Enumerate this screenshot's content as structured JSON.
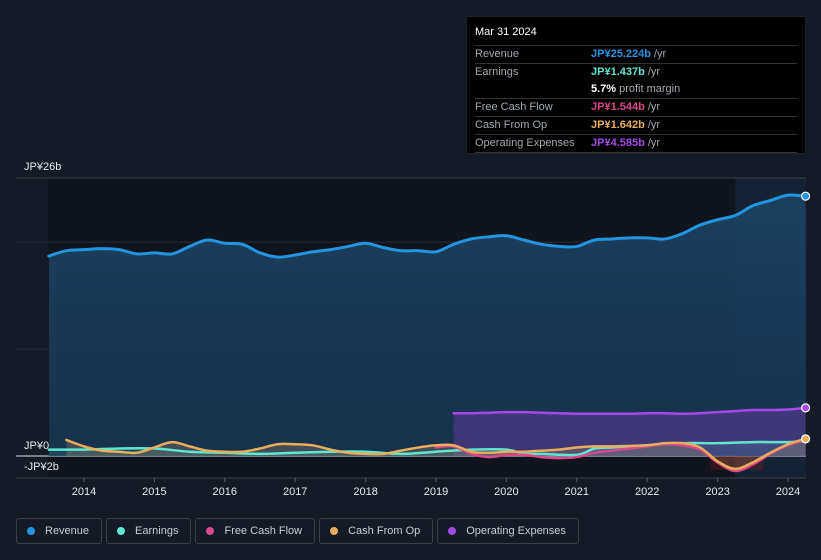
{
  "tooltip": {
    "date": "Mar 31 2024",
    "rows": [
      {
        "label": "Revenue",
        "value": "JP¥25.224b",
        "unit": "/yr",
        "color": "#2394df"
      },
      {
        "label": "Earnings",
        "value": "JP¥1.437b",
        "unit": "/yr",
        "color": "#5ee6d0"
      },
      {
        "label": "",
        "value": "5.7%",
        "unit": "profit margin",
        "color": "#ffffff"
      },
      {
        "label": "Free Cash Flow",
        "value": "JP¥1.544b",
        "unit": "/yr",
        "color": "#d9488b"
      },
      {
        "label": "Cash From Op",
        "value": "JP¥1.642b",
        "unit": "/yr",
        "color": "#e9ad5b"
      },
      {
        "label": "Operating Expenses",
        "value": "JP¥4.585b",
        "unit": "/yr",
        "color": "#a548e8"
      }
    ]
  },
  "legend": [
    {
      "label": "Revenue",
      "color": "#2394df"
    },
    {
      "label": "Earnings",
      "color": "#5ee6d0"
    },
    {
      "label": "Free Cash Flow",
      "color": "#d9488b"
    },
    {
      "label": "Cash From Op",
      "color": "#e9ad5b"
    },
    {
      "label": "Operating Expenses",
      "color": "#a548e8"
    }
  ],
  "chart_data": {
    "type": "area",
    "title": "",
    "xlabel": "",
    "ylabel": "",
    "y_tick_labels": {
      "top": "JP¥26b",
      "zero": "JP¥0",
      "bottom": "-JP¥2b"
    },
    "ylim": [
      -2,
      26
    ],
    "xlim": [
      2013.15,
      2024.3
    ],
    "x_ticks": [
      2014,
      2015,
      2016,
      2017,
      2018,
      2019,
      2020,
      2021,
      2022,
      2023,
      2024
    ],
    "highlight_from": 2023.25,
    "grid": true,
    "legend_position": "bottom-left",
    "series": [
      {
        "name": "Revenue",
        "color": "#2394df",
        "fill": true,
        "x": [
          2013.5,
          2013.75,
          2014.0,
          2014.25,
          2014.5,
          2014.75,
          2015.0,
          2015.25,
          2015.5,
          2015.75,
          2016.0,
          2016.25,
          2016.5,
          2016.75,
          2017.0,
          2017.25,
          2017.5,
          2017.75,
          2018.0,
          2018.25,
          2018.5,
          2018.75,
          2019.0,
          2019.25,
          2019.5,
          2019.75,
          2020.0,
          2020.25,
          2020.5,
          2020.75,
          2021.0,
          2021.25,
          2021.5,
          2021.75,
          2022.0,
          2022.25,
          2022.5,
          2022.75,
          2023.0,
          2023.25,
          2023.5,
          2023.75,
          2024.0,
          2024.25
        ],
        "values": [
          18.7,
          19.2,
          19.3,
          19.4,
          19.3,
          18.9,
          19.0,
          18.9,
          19.6,
          20.2,
          19.9,
          19.8,
          19.0,
          18.6,
          18.8,
          19.1,
          19.3,
          19.6,
          19.9,
          19.5,
          19.2,
          19.2,
          19.1,
          19.8,
          20.3,
          20.5,
          20.6,
          20.2,
          19.8,
          19.6,
          19.6,
          20.2,
          20.3,
          20.4,
          20.4,
          20.3,
          20.8,
          21.6,
          22.1,
          22.5,
          23.4,
          23.9,
          24.4,
          24.3
        ]
      },
      {
        "name": "Operating Expenses",
        "color": "#a548e8",
        "fill": true,
        "x": [
          2019.25,
          2019.5,
          2019.75,
          2020.0,
          2020.25,
          2020.5,
          2020.75,
          2021.0,
          2021.25,
          2021.5,
          2021.75,
          2022.0,
          2022.25,
          2022.5,
          2022.75,
          2023.0,
          2023.25,
          2023.5,
          2023.75,
          2024.0,
          2024.25
        ],
        "values": [
          4.0,
          4.0,
          4.05,
          4.1,
          4.1,
          4.05,
          4.0,
          3.95,
          3.95,
          3.95,
          3.95,
          4.0,
          4.0,
          3.95,
          4.0,
          4.1,
          4.2,
          4.3,
          4.3,
          4.35,
          4.5
        ]
      },
      {
        "name": "Earnings",
        "color": "#5ee6d0",
        "fill": true,
        "x": [
          2013.5,
          2014.0,
          2014.5,
          2015.0,
          2015.5,
          2016.0,
          2016.5,
          2017.0,
          2017.5,
          2018.0,
          2018.5,
          2019.0,
          2019.5,
          2020.0,
          2020.25,
          2020.5,
          2021.0,
          2021.25,
          2021.5,
          2022.0,
          2022.5,
          2023.0,
          2023.5,
          2024.0,
          2024.25
        ],
        "values": [
          0.6,
          0.6,
          0.7,
          0.7,
          0.4,
          0.3,
          0.2,
          0.3,
          0.4,
          0.4,
          0.2,
          0.4,
          0.6,
          0.6,
          0.2,
          0.2,
          0.1,
          0.7,
          0.8,
          1.0,
          1.2,
          1.2,
          1.3,
          1.3,
          1.4
        ]
      },
      {
        "name": "Free Cash Flow",
        "color": "#d9488b",
        "fill": false,
        "x": [
          2019.0,
          2019.25,
          2019.5,
          2019.75,
          2020.0,
          2020.25,
          2020.5,
          2020.75,
          2021.0,
          2021.25,
          2021.5,
          2022.0,
          2022.25,
          2022.5,
          2022.75,
          2023.0,
          2023.25,
          2023.5,
          2023.75,
          2024.0,
          2024.25
        ],
        "values": [
          0.8,
          0.9,
          0.2,
          -0.1,
          0.1,
          0.1,
          -0.1,
          -0.2,
          -0.1,
          0.3,
          0.5,
          0.9,
          1.1,
          1.0,
          0.6,
          -0.6,
          -1.4,
          -0.8,
          0.2,
          1.0,
          1.5
        ]
      },
      {
        "name": "Cash From Op",
        "color": "#e9ad5b",
        "fill": true,
        "x": [
          2013.75,
          2014.0,
          2014.25,
          2014.5,
          2014.75,
          2015.0,
          2015.25,
          2015.5,
          2015.75,
          2016.0,
          2016.25,
          2016.5,
          2016.75,
          2017.0,
          2017.25,
          2017.5,
          2017.75,
          2018.0,
          2018.25,
          2018.5,
          2018.75,
          2019.0,
          2019.25,
          2019.5,
          2019.75,
          2020.0,
          2020.25,
          2020.5,
          2020.75,
          2021.0,
          2021.25,
          2021.5,
          2022.0,
          2022.25,
          2022.5,
          2022.75,
          2023.0,
          2023.25,
          2023.5,
          2023.75,
          2024.0,
          2024.25
        ],
        "values": [
          1.5,
          0.9,
          0.5,
          0.4,
          0.3,
          0.8,
          1.3,
          0.9,
          0.5,
          0.4,
          0.4,
          0.7,
          1.1,
          1.1,
          1.0,
          0.6,
          0.3,
          0.2,
          0.2,
          0.5,
          0.8,
          1.0,
          1.0,
          0.4,
          0.3,
          0.4,
          0.4,
          0.5,
          0.6,
          0.8,
          0.9,
          0.9,
          1.0,
          1.2,
          1.2,
          0.8,
          -0.5,
          -1.2,
          -0.6,
          0.3,
          1.1,
          1.6
        ]
      }
    ]
  }
}
